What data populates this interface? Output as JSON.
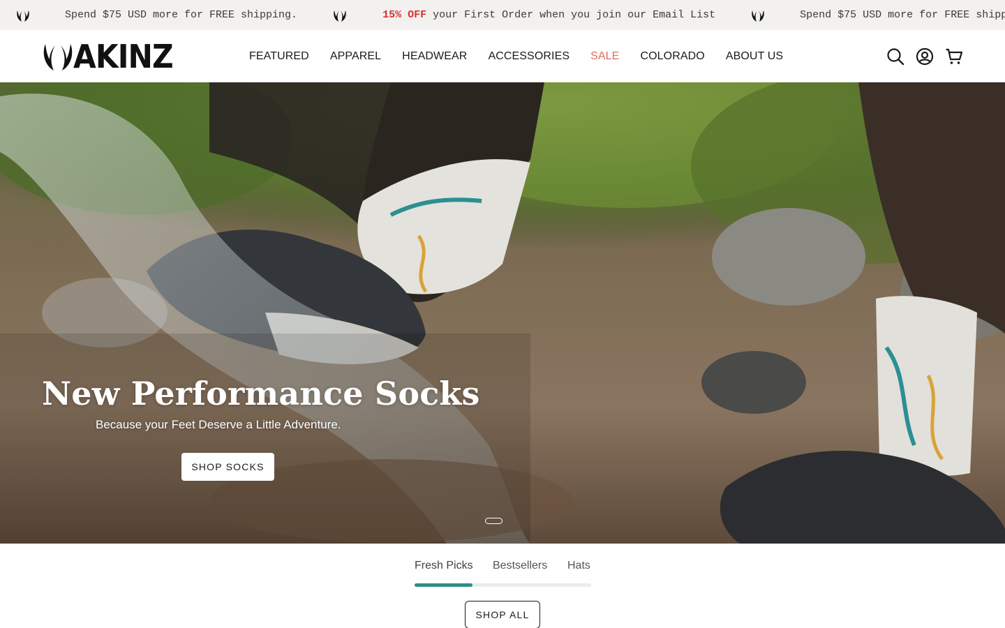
{
  "announcement": {
    "icon": "wings-logo-icon",
    "messages": [
      {
        "prefix": "",
        "text": "Spend $75 USD more for FREE shipping."
      },
      {
        "prefix": "15% OFF",
        "text": " your First Order when you join our Email List"
      },
      {
        "prefix": "",
        "text": "Spend $75 USD more for FREE shipping."
      }
    ],
    "accent_color": "#d9302c",
    "background": "#f2f1ef"
  },
  "header": {
    "logo_text": "AKINZ",
    "nav": [
      {
        "label": "FEATURED"
      },
      {
        "label": "APPAREL"
      },
      {
        "label": "HEADWEAR"
      },
      {
        "label": "ACCESSORIES"
      },
      {
        "label": "SALE",
        "highlight": true
      },
      {
        "label": "COLORADO"
      },
      {
        "label": "ABOUT US"
      }
    ],
    "sale_color": "#e26a5f",
    "icons": [
      "search-icon",
      "account-icon",
      "cart-icon"
    ]
  },
  "hero": {
    "title": "New Performance Socks",
    "subtitle": "Because your Feet Deserve a Little Adventure.",
    "button_label": "SHOP SOCKS",
    "slide_indicator": {
      "current": 1,
      "total": 1
    }
  },
  "collection_tabs": {
    "tabs": [
      {
        "label": "Fresh Picks",
        "active": true
      },
      {
        "label": "Bestsellers",
        "active": false
      },
      {
        "label": "Hats",
        "active": false
      }
    ],
    "progress_fraction": 0.33,
    "progress_color": "#2e8f86",
    "shop_all_label": "SHOP ALL"
  }
}
